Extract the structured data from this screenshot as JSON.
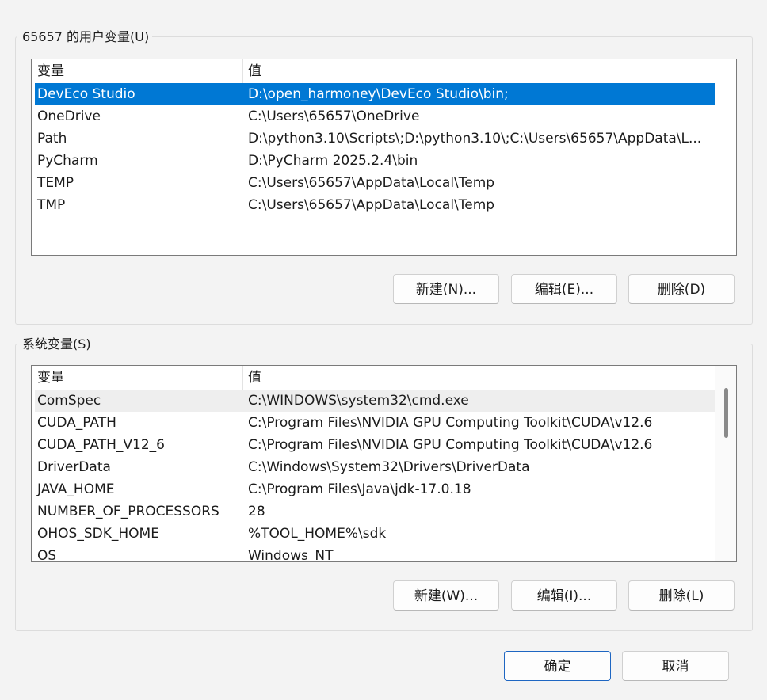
{
  "user_vars": {
    "title": "65657 的用户变量(U)",
    "header": {
      "name": "变量",
      "value": "值"
    },
    "rows": [
      {
        "name": "DevEco Studio",
        "value": "D:\\open_harmoney\\DevEco Studio\\bin;"
      },
      {
        "name": "OneDrive",
        "value": "C:\\Users\\65657\\OneDrive"
      },
      {
        "name": "Path",
        "value": "D:\\python3.10\\Scripts\\;D:\\python3.10\\;C:\\Users\\65657\\AppData\\L..."
      },
      {
        "name": "PyCharm",
        "value": "D:\\PyCharm 2025.2.4\\bin"
      },
      {
        "name": "TEMP",
        "value": "C:\\Users\\65657\\AppData\\Local\\Temp"
      },
      {
        "name": "TMP",
        "value": "C:\\Users\\65657\\AppData\\Local\\Temp"
      }
    ],
    "selected_index": 0,
    "buttons": {
      "new": "新建(N)...",
      "edit": "编辑(E)...",
      "delete": "删除(D)"
    }
  },
  "system_vars": {
    "title": "系统变量(S)",
    "header": {
      "name": "变量",
      "value": "值"
    },
    "rows": [
      {
        "name": "ComSpec",
        "value": "C:\\WINDOWS\\system32\\cmd.exe"
      },
      {
        "name": "CUDA_PATH",
        "value": "C:\\Program Files\\NVIDIA GPU Computing Toolkit\\CUDA\\v12.6"
      },
      {
        "name": "CUDA_PATH_V12_6",
        "value": "C:\\Program Files\\NVIDIA GPU Computing Toolkit\\CUDA\\v12.6"
      },
      {
        "name": "DriverData",
        "value": "C:\\Windows\\System32\\Drivers\\DriverData"
      },
      {
        "name": "JAVA_HOME",
        "value": "C:\\Program Files\\Java\\jdk-17.0.18"
      },
      {
        "name": "NUMBER_OF_PROCESSORS",
        "value": "28"
      },
      {
        "name": "OHOS_SDK_HOME",
        "value": "%TOOL_HOME%\\sdk"
      },
      {
        "name": "OS",
        "value": "Windows_NT"
      }
    ],
    "hovered_index": 0,
    "buttons": {
      "new": "新建(W)...",
      "edit": "编辑(I)...",
      "delete": "删除(L)"
    }
  },
  "dialog": {
    "ok": "确定",
    "cancel": "取消"
  },
  "colors": {
    "selection": "#0078d4",
    "hover": "#eeeeee",
    "background": "#f3f3f3"
  }
}
